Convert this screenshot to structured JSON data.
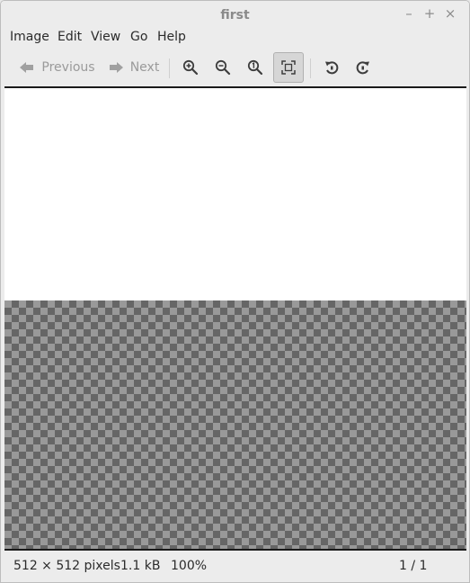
{
  "window": {
    "title": "first",
    "controls": {
      "minimize": "–",
      "maximize": "+",
      "close": "×"
    }
  },
  "menu": {
    "items": [
      "Image",
      "Edit",
      "View",
      "Go",
      "Help"
    ]
  },
  "toolbar": {
    "previous_label": "Previous",
    "next_label": "Next",
    "icons": [
      "arrow-left-icon",
      "arrow-right-icon",
      "zoom-in-icon",
      "zoom-out-icon",
      "zoom-normal-icon",
      "zoom-fit-icon",
      "rotate-left-icon",
      "rotate-right-icon"
    ]
  },
  "status": {
    "dimensions": "512 × 512 pixels",
    "filesize": "1.1 kB",
    "zoom": "100%",
    "position": "1 / 1"
  },
  "colors": {
    "checker_dark": "#666666",
    "checker_light": "#999999"
  }
}
